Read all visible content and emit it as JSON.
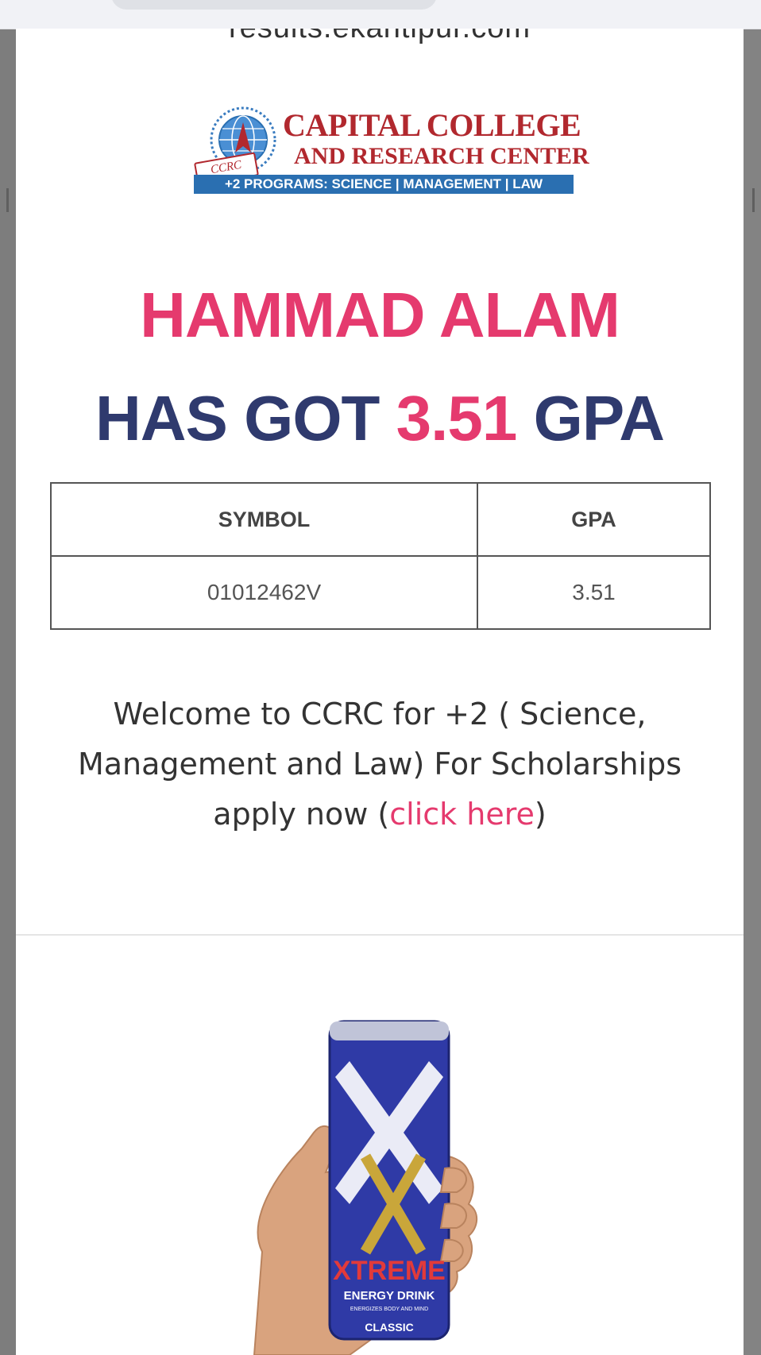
{
  "browser": {
    "url": "results.ekantipur.com"
  },
  "college": {
    "name_line1": "CAPITAL COLLEGE",
    "name_line2": "AND RESEARCH CENTER",
    "abbr": "CCRC",
    "programs": "+2 PROGRAMS: SCIENCE | MANAGEMENT | LAW",
    "brand_color": "#b1282e"
  },
  "result": {
    "student_name": "HAMMAD ALAM",
    "has_got": "HAS GOT",
    "gpa_value": "3.51",
    "gpa_unit": "GPA",
    "table": {
      "headers": [
        "SYMBOL",
        "GPA"
      ],
      "rows": [
        [
          "01012462V",
          "3.51"
        ]
      ]
    }
  },
  "welcome": {
    "text": "Welcome to CCRC for +2 ( Science, Management and Law) For Scholarships apply now (",
    "link_label": "click here",
    "close": ")"
  },
  "ad": {
    "brand_label": "XTREME",
    "sub_label": "ENERGY DRINK",
    "tagline": "ENERGIZES BODY AND MIND",
    "variant": "CLASSIC"
  },
  "colors": {
    "accent": "#e53a6e",
    "navy": "#2f3a6e"
  }
}
